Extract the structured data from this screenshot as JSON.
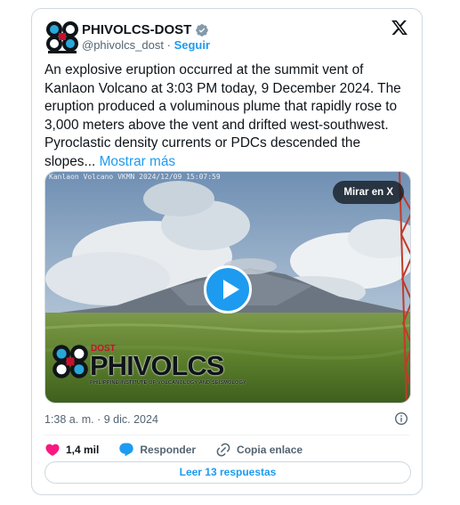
{
  "author": {
    "name": "PHIVOLCS-DOST",
    "handle": "@phivolcs_dost",
    "separator": "·",
    "follow_label": "Seguir"
  },
  "tweet": {
    "text": "An explosive eruption occurred at the summit vent of Kanlaon Volcano at 3:03 PM today, 9 December 2024. The eruption produced a voluminous plume that rapidly rose to 3,000 meters above the vent and drifted west-southwest. Pyroclastic density currents or PDCs descended the slopes...",
    "show_more": "Mostrar más"
  },
  "media": {
    "camera_timestamp": "Kanlaon Volcano VKMN 2024/12/09 15:07:59",
    "watch_label": "Mirar en X",
    "watermark_name": "PHIVOLCS",
    "watermark_dost": "DOST",
    "watermark_sub": "PHILIPPINE INSTITUTE OF VOLCANOLOGY AND SEISMOLOGY"
  },
  "meta": {
    "time": "1:38 a. m.",
    "separator": "·",
    "date": "9 dic. 2024"
  },
  "actions": {
    "likes": "1,4 mil",
    "reply_label": "Responder",
    "copy_label": "Copia enlace"
  },
  "replies_button": "Leer 13 respuestas",
  "colors": {
    "accent": "#1d9bf0",
    "like": "#f91880",
    "text": "#0f1419",
    "muted": "#536471",
    "border": "#cfd9de"
  },
  "icons": [
    "phivolcs-logo-icon",
    "verified-icon",
    "x-logo-icon",
    "play-icon",
    "info-icon",
    "heart-icon",
    "reply-icon",
    "link-icon"
  ]
}
